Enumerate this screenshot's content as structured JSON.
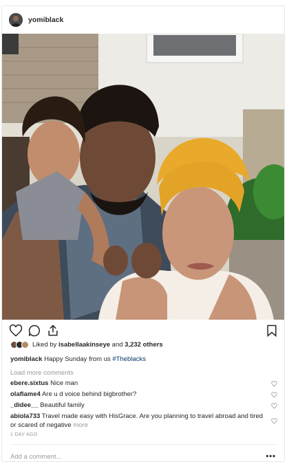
{
  "post": {
    "username": "yomiblack",
    "avatar_icon": "profile-avatar",
    "photo_alt": "family selfie"
  },
  "actions": {
    "like_icon": "heart-icon",
    "comment_icon": "comment-icon",
    "share_icon": "share-icon",
    "save_icon": "bookmark-icon"
  },
  "likes": {
    "prefix": "Liked by ",
    "user": "isabellaakinseye",
    "middle": " and ",
    "count": "3,232 others"
  },
  "caption": {
    "username": "yomiblack",
    "text": " Happy Sunday from us ",
    "hashtag": "#Theblacks"
  },
  "load_more": "Load more comments",
  "comments": [
    {
      "user": "ebere.sixtus",
      "text": " Nice man"
    },
    {
      "user": "olaflame4",
      "text": " Are u d voice behind bigbrother?"
    },
    {
      "user": "_didee__",
      "text": " Beautiful family"
    },
    {
      "user": "abiola733",
      "text": " Travel made easy with HisGrace. Are you planning to travel abroad and tired or scared of negative ",
      "more": "more"
    }
  ],
  "timestamp": "1 DAY AGO",
  "add_comment_placeholder": "Add a comment...",
  "options_label": "•••",
  "colors": {
    "text": "#262626",
    "muted": "#999999",
    "hashtag": "#003569",
    "border": "#e6e6e6"
  }
}
